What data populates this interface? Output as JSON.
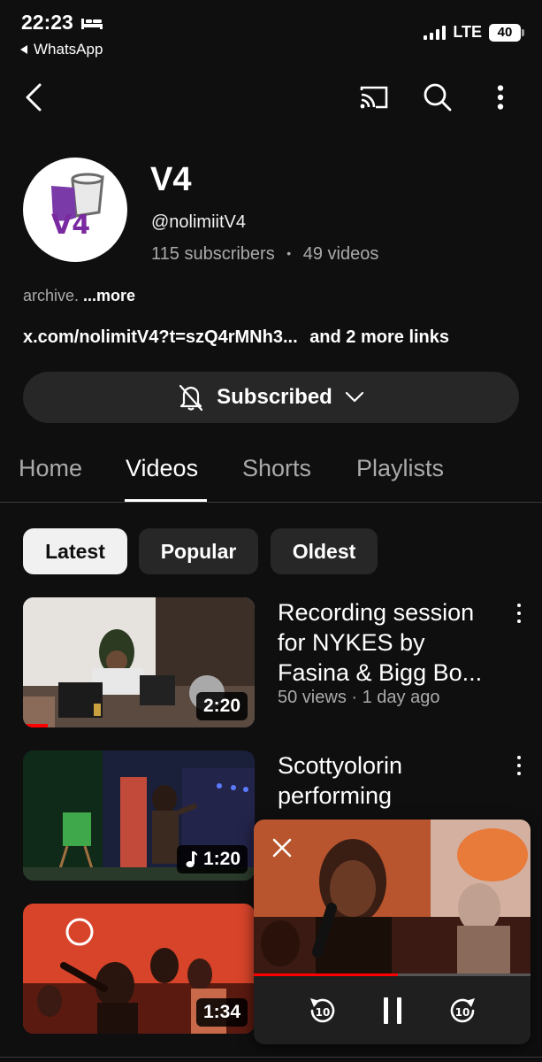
{
  "status_bar": {
    "time": "22:23",
    "back_app": "WhatsApp",
    "network": "LTE",
    "battery": "40"
  },
  "top_nav": {
    "icons": [
      "back-arrow-icon",
      "cast-icon",
      "search-icon",
      "more-vertical-icon"
    ]
  },
  "channel": {
    "avatar_text": "V4",
    "name": "V4",
    "handle": "@nolimiitV4",
    "subscribers": "115 subscribers",
    "separator": "•",
    "videos_count": "49 videos",
    "description": "archive.",
    "description_more": "...more",
    "link": "x.com/nolimitV4?t=szQ4rMNh3...",
    "more_links": "and 2 more links",
    "subscribe_label": "Subscribed"
  },
  "tabs": [
    {
      "label": "Home"
    },
    {
      "label": "Videos"
    },
    {
      "label": "Shorts"
    },
    {
      "label": "Playlists"
    }
  ],
  "active_tab": "Videos",
  "chips": [
    {
      "label": "Latest"
    },
    {
      "label": "Popular"
    },
    {
      "label": "Oldest"
    }
  ],
  "active_chip": "Latest",
  "videos": [
    {
      "title": "Recording session for NYKES by Fasina & Bigg Bo...",
      "meta": "50 views · 1 day ago",
      "duration": "2:20"
    },
    {
      "title": "Scottyolorin performing TRABAYE 1.0",
      "meta": "",
      "duration": "1:20"
    },
    {
      "title": "",
      "meta": "",
      "duration": "1:34"
    }
  ],
  "mini_player": {
    "progress": 0.52,
    "controls": [
      "replay-10-icon",
      "pause-icon",
      "forward-10-icon"
    ],
    "rewind_label": "10",
    "forward_label": "10"
  },
  "colors": {
    "background": "#0f0f0f",
    "chip_bg": "#272727",
    "chip_active_bg": "#f1f1f1",
    "secondary_text": "#aaaaaa",
    "accent_red": "#ff0000",
    "avatar_purple": "#6a2a9a"
  }
}
